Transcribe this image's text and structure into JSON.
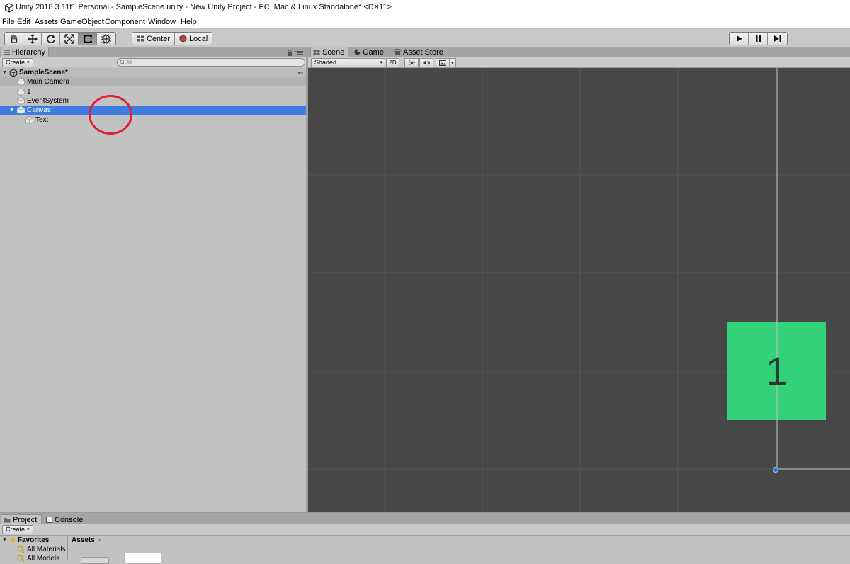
{
  "window": {
    "title": "Unity 2018.3.11f1 Personal - SampleScene.unity - New Unity Project - PC, Mac & Linux Standalone* <DX11>"
  },
  "menu": [
    "File",
    "Edit",
    "Assets",
    "GameObject",
    "Component",
    "Window",
    "Help"
  ],
  "toolbar": {
    "tools": [
      "hand-icon",
      "move-icon",
      "rotate-icon",
      "scale-icon",
      "rect-tool-icon",
      "transform-tool-icon"
    ],
    "active_tool": "rect-tool-icon",
    "pivot_label": "Center",
    "space_label": "Local",
    "playback": [
      "play-icon",
      "pause-icon",
      "step-icon"
    ]
  },
  "hierarchy": {
    "tab_label": "Hierarchy",
    "create_label": "Create",
    "search_placeholder": "All",
    "scene_name": "SampleScene*",
    "items": [
      {
        "label": "Main Camera",
        "highlighted": true
      },
      {
        "label": "1"
      },
      {
        "label": "EventSystem"
      },
      {
        "label": "Canvas",
        "selected": true,
        "expanded": true
      },
      {
        "label": "Text",
        "child": true
      }
    ]
  },
  "scene": {
    "tabs": [
      "Scene",
      "Game",
      "Asset Store"
    ],
    "active_tab": "Scene",
    "shading_mode": "Shaded",
    "mode_2d_label": "2D",
    "object_text": "1",
    "object_color": "#32d17a",
    "background_color": "#474747"
  },
  "annotation": {
    "color": "#e02030"
  },
  "project": {
    "tabs": [
      "Project",
      "Console"
    ],
    "create_label": "Create",
    "favorites_label": "Favorites",
    "favorites": [
      "All Materials",
      "All Models"
    ],
    "breadcrumb": "Assets"
  },
  "colors": {
    "selection": "#3e7ce0",
    "panel": "#c2c2c2"
  }
}
